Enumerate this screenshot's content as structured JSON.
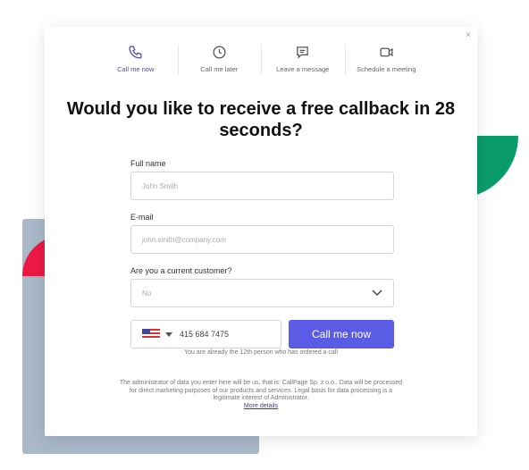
{
  "tabs": [
    {
      "label": "Call me now",
      "icon": "phone-icon",
      "active": true
    },
    {
      "label": "Call me later",
      "icon": "clock-icon"
    },
    {
      "label": "Leave a message",
      "icon": "message-icon"
    },
    {
      "label": "Schedule a meeting",
      "icon": "video-icon"
    }
  ],
  "close": "×",
  "title": "Would you like to receive a free callback in 28 seconds?",
  "form": {
    "full_name_label": "Full name",
    "full_name_placeholder": "John Smith",
    "email_label": "E-mail",
    "email_placeholder": "john.smith@company.com",
    "customer_label": "Are you a current customer?",
    "customer_value": "No",
    "phone_value": "415 684 7475",
    "country_flag": "US",
    "submit": "Call me now"
  },
  "info": "You are already the 12th person who has ordered a call",
  "legal": "The administrator of data you enter here will be us, that is: CallPage Sp. z o.o.. Data will be processed for direct marketing purposes of our products and services. Legal basis for data processing is a legitimate interest of Administrator.",
  "more_details": "More details",
  "colors": {
    "accent": "#5b5ce6",
    "red": "#ee1846",
    "green": "#0a9b6c",
    "backdrop": "#a9b9c9"
  }
}
